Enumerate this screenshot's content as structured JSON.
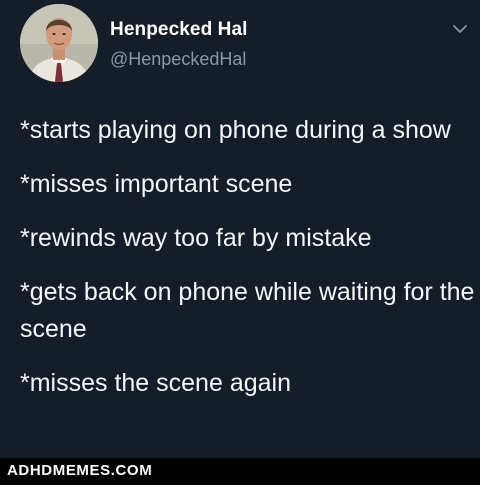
{
  "tweet": {
    "display_name": "Henpecked Hal",
    "handle": "@HenpeckedHal",
    "avatar_icon": "user-avatar-photo",
    "menu_icon": "chevron-down-icon",
    "lines": [
      "*starts playing on phone during a show",
      "*misses important scene",
      "*rewinds way too far by mistake",
      "*gets back on phone while waiting for the scene",
      "*misses the scene again"
    ]
  },
  "watermark": {
    "text": "ADHDMEMES.COM"
  },
  "colors": {
    "background": "#151d28",
    "handle": "#8b98a5",
    "text": "#f4f6f8",
    "watermark_bg": "#000000"
  }
}
